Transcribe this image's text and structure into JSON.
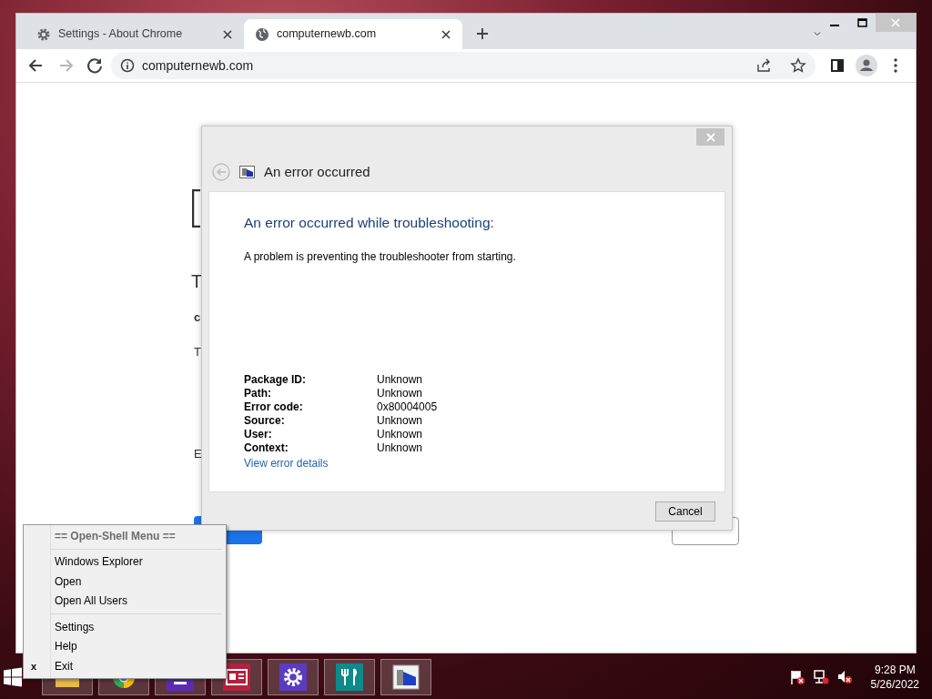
{
  "browser": {
    "tabs": [
      {
        "label": "Settings - About Chrome",
        "selected": false
      },
      {
        "label": "computernewb.com",
        "selected": true
      }
    ],
    "address": "computernewb.com"
  },
  "page_fragments": [
    {
      "kind": "heading",
      "text": "T"
    },
    {
      "kind": "bold",
      "text": "c"
    },
    {
      "kind": "plain",
      "text": "T"
    },
    {
      "kind": "plain",
      "text": "E"
    }
  ],
  "dialog": {
    "title": "An error occurred",
    "heading": "An error occurred while troubleshooting:",
    "message": "A problem is preventing the troubleshooter from starting.",
    "details": [
      {
        "label": "Package ID:",
        "value": "Unknown"
      },
      {
        "label": "Path:",
        "value": "Unknown"
      },
      {
        "label": "Error code:",
        "value": "0x80004005"
      },
      {
        "label": "Source:",
        "value": "Unknown"
      },
      {
        "label": "User:",
        "value": "Unknown"
      },
      {
        "label": "Context:",
        "value": "Unknown"
      }
    ],
    "link": "View error details",
    "buttons": [
      "Cancel"
    ]
  },
  "context_menu": {
    "header": "== Open-Shell Menu ==",
    "groups": [
      [
        {
          "label": "Windows Explorer"
        },
        {
          "label": "Open"
        },
        {
          "label": "Open All Users"
        }
      ],
      [
        {
          "label": "Settings"
        },
        {
          "label": "Help"
        },
        {
          "label": "Exit",
          "mark": "x"
        }
      ]
    ]
  },
  "taskbar": {
    "time": "9:28 PM",
    "date": "5/26/2022"
  }
}
